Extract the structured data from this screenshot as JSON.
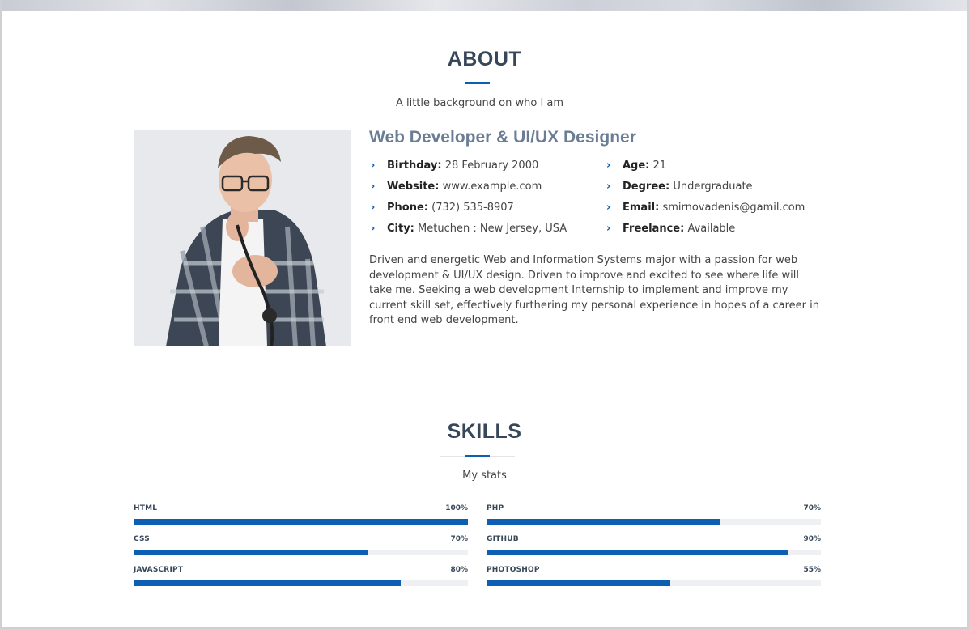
{
  "about": {
    "title": "ABOUT",
    "subtitle": "A little background on who I am",
    "role": "Web Developer & UI/UX Designer",
    "info_left": [
      {
        "label": "Birthday:",
        "value": "28 February 2000"
      },
      {
        "label": "Website:",
        "value": "www.example.com"
      },
      {
        "label": "Phone:",
        "value": "(732) 535-8907"
      },
      {
        "label": "City:",
        "value": "Metuchen : New Jersey, USA"
      }
    ],
    "info_right": [
      {
        "label": "Age:",
        "value": "21"
      },
      {
        "label": "Degree:",
        "value": "Undergraduate"
      },
      {
        "label": "Email:",
        "value": "smirnovadenis@gamil.com"
      },
      {
        "label": "Freelance:",
        "value": "Available"
      }
    ],
    "bio": "Driven and energetic Web and Information Systems major with a passion for web development & UI/UX design. Driven to improve and excited to see where life will take me. Seeking a web development Internship to implement and improve my current skill set, effectively furthering my personal experience in hopes of a career in front end web development.",
    "chevron_icon": "chevron-right-icon"
  },
  "skills": {
    "title": "SKILLS",
    "subtitle": "My stats",
    "left": [
      {
        "name": "HTML",
        "percent_label": "100%",
        "percent": 100
      },
      {
        "name": "CSS",
        "percent_label": "70%",
        "percent": 70
      },
      {
        "name": "JAVASCRIPT",
        "percent_label": "80%",
        "percent": 80
      }
    ],
    "right": [
      {
        "name": "PHP",
        "percent_label": "70%",
        "percent": 70
      },
      {
        "name": "GITHUB",
        "percent_label": "90%",
        "percent": 90
      },
      {
        "name": "PHOTOSHOP",
        "percent_label": "55%",
        "percent": 55
      }
    ]
  },
  "colors": {
    "accent": "#0d5fb4",
    "heading": "#37475a",
    "role": "#6b7d95",
    "track": "#eef0f4"
  }
}
